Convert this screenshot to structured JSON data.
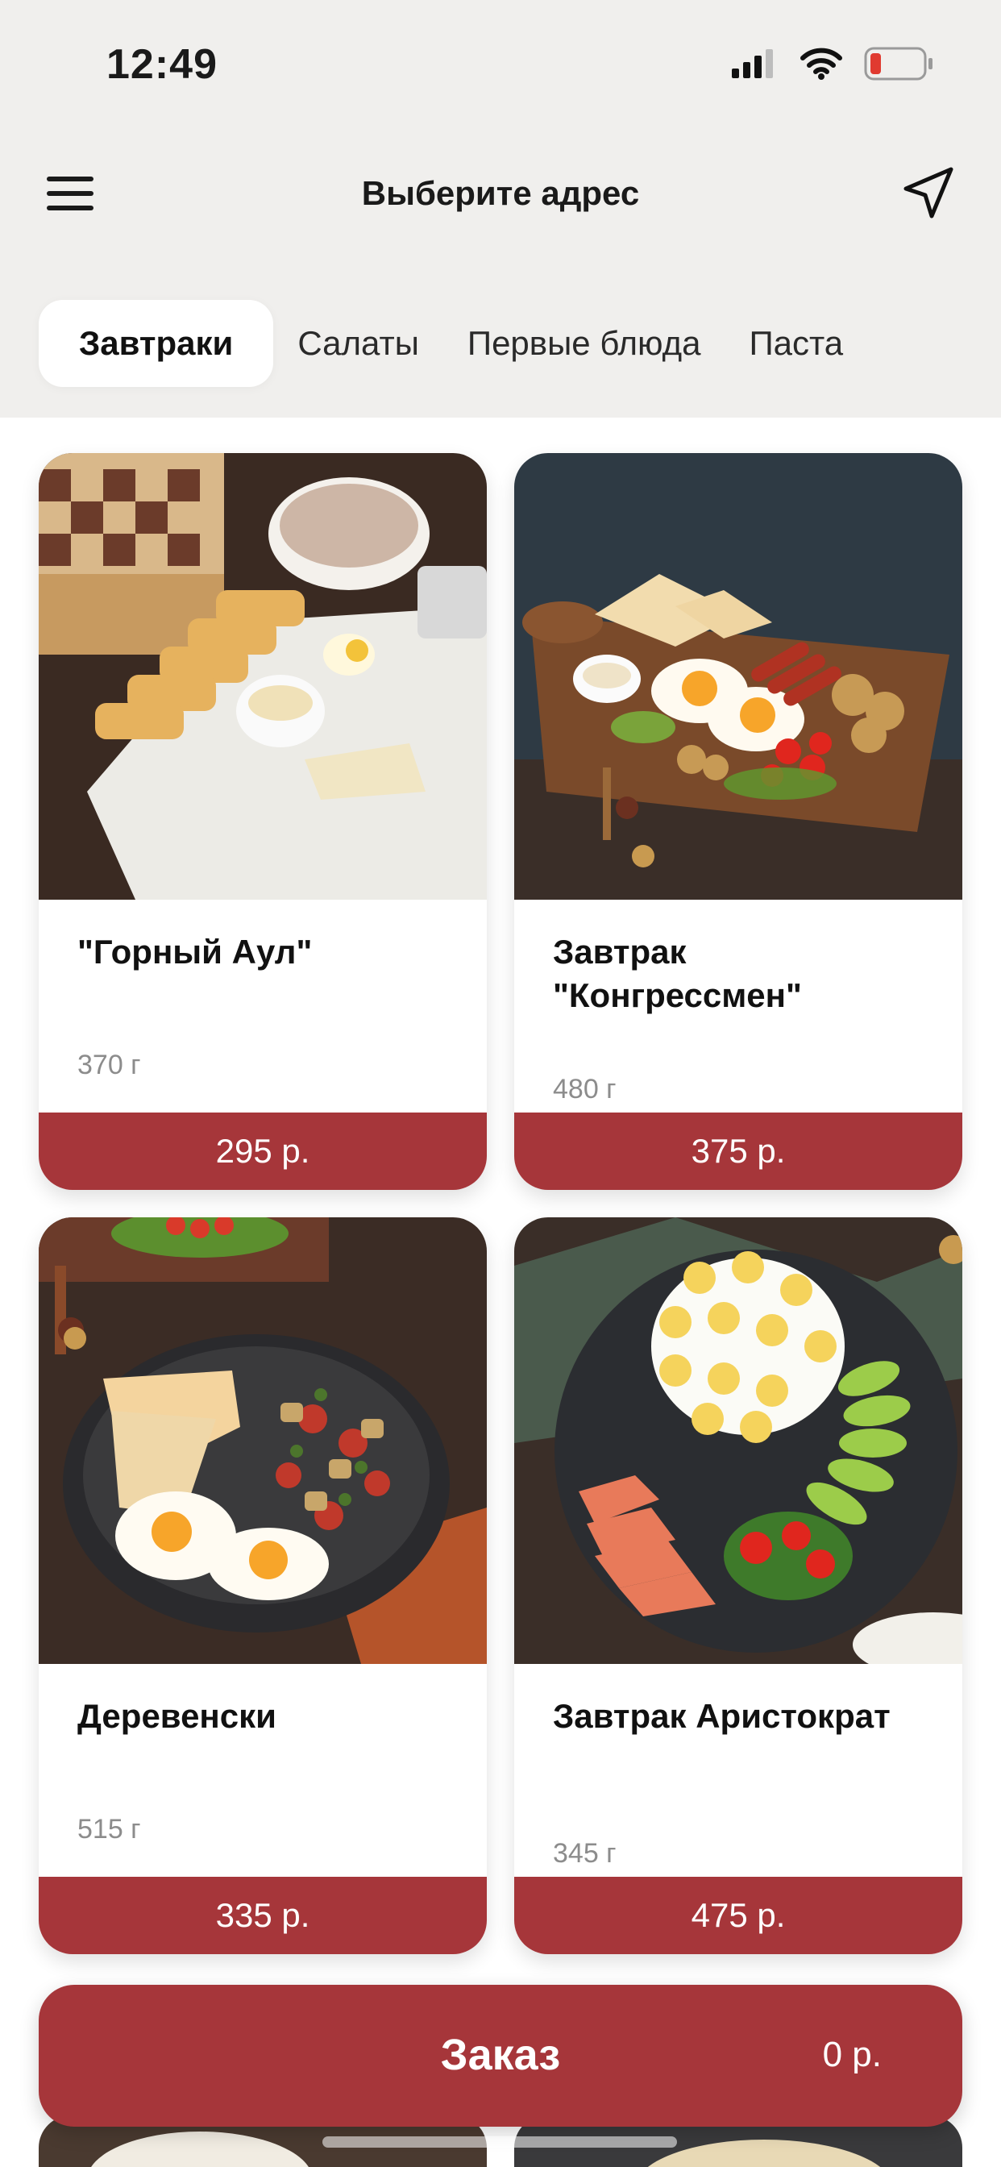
{
  "status_bar": {
    "time": "12:49",
    "icons": [
      "signal-icon",
      "wifi-icon",
      "battery-icon"
    ],
    "battery_level": 0.15
  },
  "header": {
    "title": "Выберите адрес",
    "menu_icon": "menu-icon",
    "location_icon": "navigation-arrow-icon"
  },
  "tabs": [
    {
      "label": "Завтраки",
      "active": true
    },
    {
      "label": "Салаты",
      "active": false
    },
    {
      "label": "Первые блюда",
      "active": false
    },
    {
      "label": "Паста",
      "active": false
    }
  ],
  "products": [
    {
      "name": "\"Горный Аул\"",
      "weight": "370 г",
      "price": "295 р."
    },
    {
      "name": "Завтрак \"Конгрессмен\"",
      "weight": "480 г",
      "price": "375 р."
    },
    {
      "name": "Деревенски",
      "weight": "515 г",
      "price": "335 р."
    },
    {
      "name": "Завтрак Аристократ",
      "weight": "345 г",
      "price": "475 р."
    }
  ],
  "order": {
    "label": "Заказ",
    "total": "0 р."
  },
  "colors": {
    "accent": "#a6363a",
    "background": "#f0efed",
    "card": "#ffffff",
    "muted_text": "#8c8c8c"
  }
}
